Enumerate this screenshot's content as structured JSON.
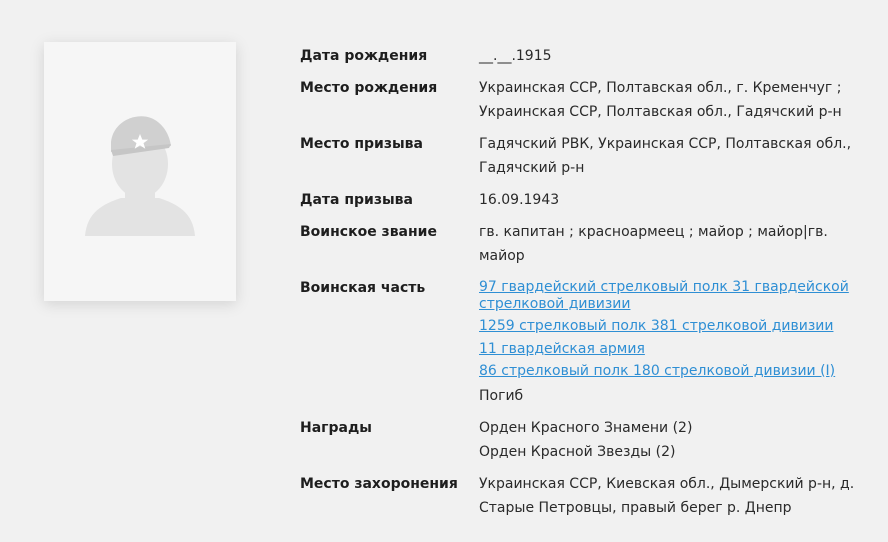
{
  "profile": {
    "avatar_icon": "soldier-silhouette-icon"
  },
  "fields": {
    "birth_date": {
      "label": "Дата рождения",
      "value": "__.__.1915"
    },
    "birth_place": {
      "label": "Место рождения",
      "value": "Украинская ССР, Полтавская обл., г. Кременчуг ; Украинская ССР, Полтавская обл., Гадячский р-н"
    },
    "draft_place": {
      "label": "Место призыва",
      "value": "Гадячский РВК, Украинская ССР, Полтавская обл., Гадячский р-н"
    },
    "draft_date": {
      "label": "Дата призыва",
      "value": "16.09.1943"
    },
    "rank": {
      "label": "Воинское звание",
      "value": "гв. капитан ; красноармеец ; майор ; майор|гв. майор"
    },
    "unit": {
      "label": "Воинская часть",
      "links": [
        "97 гвардейский стрелковый полк 31 гвардейской стрелковой дивизии",
        "1259 стрелковый полк 381 стрелковой дивизии",
        "11 гвардейская армия",
        "86 стрелковый полк 180 стрелковой дивизии (I)"
      ],
      "status": "Погиб"
    },
    "awards": {
      "label": "Награды",
      "items": [
        "Орден Красного Знамени (2)",
        "Орден Красной Звезды (2)"
      ]
    },
    "burial_place": {
      "label": "Место захоронения",
      "value": "Украинская ССР, Киевская обл., Дымерский р-н, д. Старые Петровцы, правый берег р. Днепр"
    }
  },
  "colors": {
    "link": "#2f8fd4",
    "background": "#f1f1f1",
    "card": "#f6f6f6"
  }
}
